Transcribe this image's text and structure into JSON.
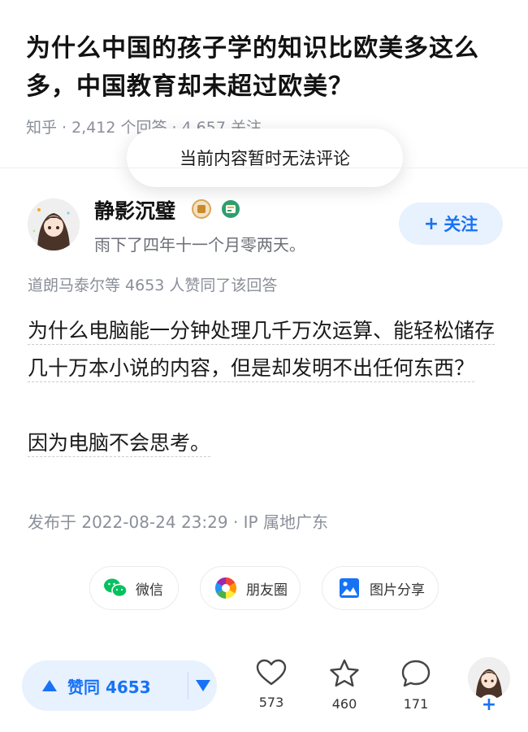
{
  "question": {
    "title": "为什么中国的孩子学的知识比欧美多这么多，中国教育却未超过欧美？",
    "source": "知乎",
    "answers": "2,412 个回答",
    "follows": "4,657 关注"
  },
  "toast": {
    "text": "当前内容暂时无法评论"
  },
  "author": {
    "name": "静影沉璧",
    "bio": "雨下了四年十一个月零两天。",
    "follow_label": "关注"
  },
  "answer": {
    "upvoters": "道朗马泰尔等 4653 人赞同了该回答",
    "paragraph1": "为什么电脑能一分钟处理几千万次运算、能轻松储存几十万本小说的内容，但是却发明不出任何东西？",
    "paragraph2": "因为电脑不会思考。",
    "publish": "发布于 2022-08-24 23:29 · IP 属地广东"
  },
  "share": {
    "wechat": "微信",
    "moments": "朋友圈",
    "image_share": "图片分享"
  },
  "bottom_bar": {
    "vote_label": "赞同 4653",
    "like_count": "573",
    "favorite_count": "460",
    "comment_count": "171"
  },
  "colors": {
    "accent": "#1772f6",
    "accent_bg": "#e8f1fe",
    "wechat_green": "#07c160"
  }
}
